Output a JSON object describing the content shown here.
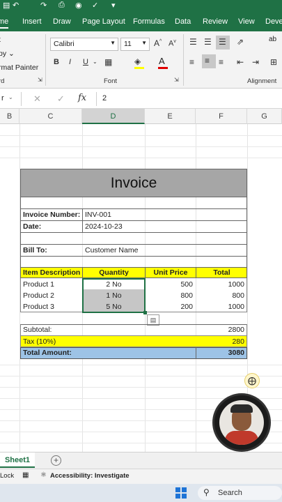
{
  "ribbon_tabs": [
    "me",
    "Insert",
    "Draw",
    "Page Layout",
    "Formulas",
    "Data",
    "Review",
    "View",
    "Deve"
  ],
  "clipboard": {
    "cut": "t",
    "copy": "py",
    "format_painter": "rmat Painter",
    "group": "rd"
  },
  "font": {
    "name": "Calibri",
    "size": "11",
    "group": "Font",
    "bold": "B",
    "italic": "I",
    "underline": "U"
  },
  "alignment": {
    "group": "Alignment",
    "wrap": "ab"
  },
  "formula_bar": {
    "name_box": "r",
    "fx": "fx",
    "value": "2"
  },
  "columns": [
    "B",
    "C",
    "D",
    "E",
    "F",
    "G"
  ],
  "invoice": {
    "title": "Invoice",
    "number_label": "Invoice Number:",
    "number": "INV-001",
    "date_label": "Date:",
    "date": "2024-10-23",
    "bill_to_label": "Bill To:",
    "bill_to": "Customer Name",
    "headers": [
      "Item Description",
      "Quantity",
      "Unit Price",
      "Total"
    ],
    "items": [
      {
        "desc": "Product 1",
        "qty": "2 No",
        "price": "500",
        "total": "1000"
      },
      {
        "desc": "Product 2",
        "qty": "1 No",
        "price": "800",
        "total": "800"
      },
      {
        "desc": "Product 3",
        "qty": "5 No",
        "price": "200",
        "total": "1000"
      }
    ],
    "subtotal_label": "Subtotal:",
    "subtotal": "2800",
    "tax_label": "Tax (10%)",
    "tax": "280",
    "total_label": "Total Amount:",
    "total": "3080"
  },
  "sheet_tab": "Sheet1",
  "status": {
    "left": "Lock",
    "accessibility": "Accessibility: Investigate"
  },
  "taskbar": {
    "search": "Search"
  },
  "colors": {
    "excel_green": "#1f7145",
    "header_yellow": "#ffff00",
    "title_gray": "#a6a6a6",
    "total_blue": "#9dc3e6"
  }
}
